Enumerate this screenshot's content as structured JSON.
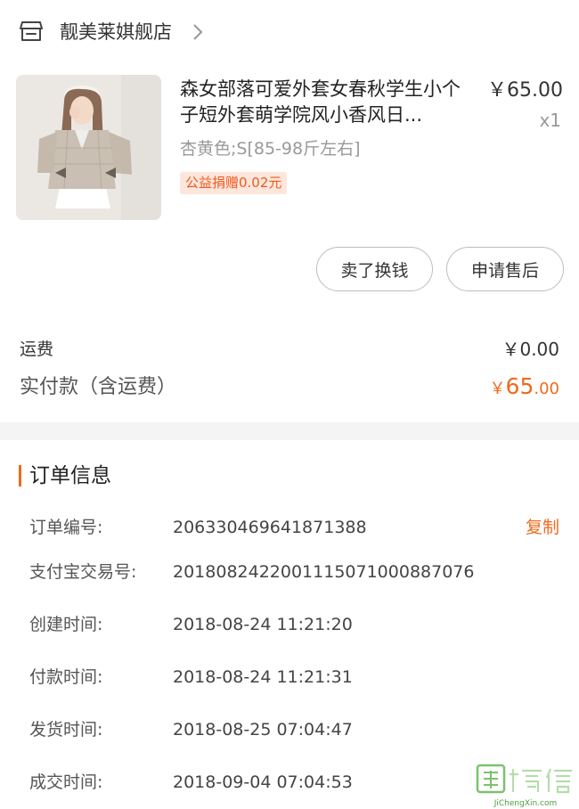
{
  "store": {
    "name": "靓美莱娸舰店"
  },
  "product": {
    "title": "森女部落可爱外套女春秋学生小个子短外套萌学院风小香风日...",
    "price": "￥65.00",
    "quantity": "x1",
    "sku": "杏黄色;S[85-98斤左右]",
    "charity_badge": "公益捐赠0.02元"
  },
  "actions": {
    "sell_label": "卖了换钱",
    "aftersale_label": "申请售后"
  },
  "summary": {
    "shipping_label": "运费",
    "shipping_value": "￥0.00",
    "paid_label": "实付款（含运费）",
    "paid_symbol": "￥",
    "paid_integer": "65",
    "paid_decimal": ".00"
  },
  "order_info": {
    "title": "订单信息",
    "copy_label": "复制",
    "rows": [
      {
        "label": "订单编号:",
        "value": "206330469641871388"
      },
      {
        "label": "支付宝交易号:",
        "value": "2018082422001115071000887076"
      },
      {
        "label": "创建时间:",
        "value": "2018-08-24 11:21:20"
      },
      {
        "label": "付款时间:",
        "value": "2018-08-24 11:21:31"
      },
      {
        "label": "发货时间:",
        "value": "2018-08-25 07:04:47"
      },
      {
        "label": "成交时间:",
        "value": "2018-09-04 07:04:53"
      }
    ]
  },
  "watermark": {
    "text": "JiChengXin.com"
  },
  "colors": {
    "accent": "#ee6a1d",
    "badge_bg": "#fde6dc",
    "divider": "#f4f4f4"
  }
}
